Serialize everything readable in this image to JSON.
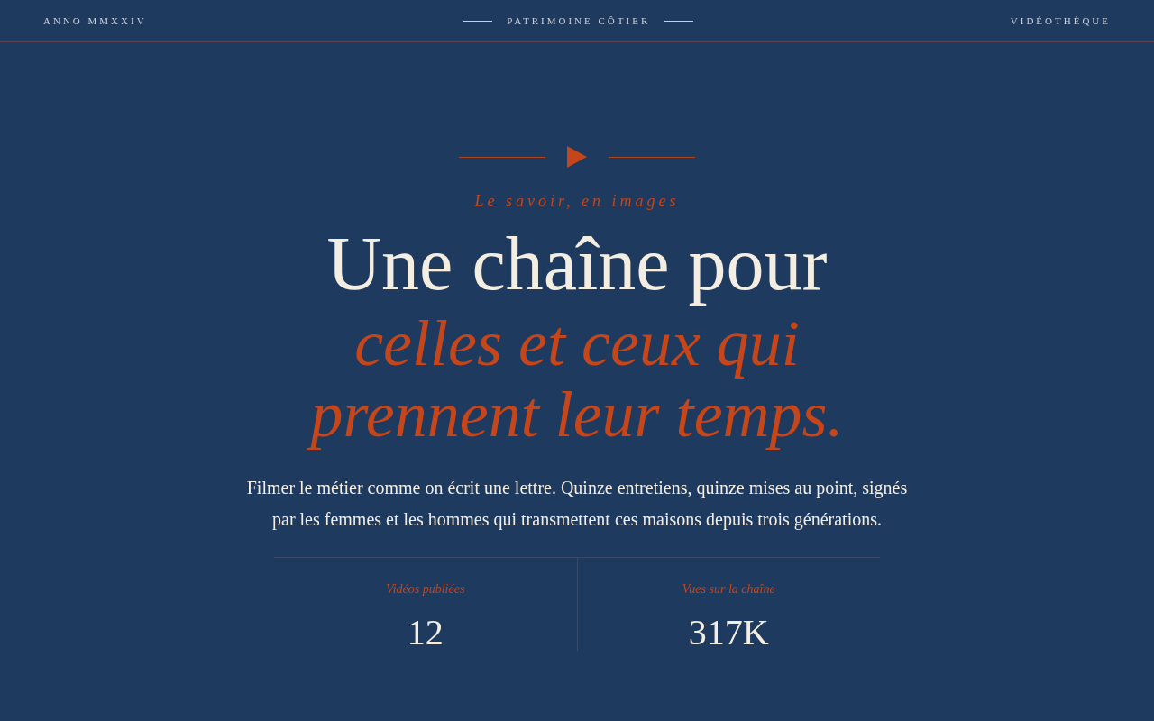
{
  "header": {
    "left": "ANNO MMXXIV",
    "center": "PATRIMOINE CÔTIER",
    "right": "VIDÉOTHÈQUE"
  },
  "hero": {
    "eyebrow": "Le savoir, en images",
    "title_line": "Une chaîne pour",
    "title_accent_lines": [
      "celles et ceux qui",
      "prennent leur temps."
    ],
    "lead": "Filmer le métier comme on écrit une lettre. Quinze entretiens, quinze mises au point, signés par les femmes et les hommes qui transmettent ces maisons depuis trois générations."
  },
  "stats": [
    {
      "label": "Vidéos publiées",
      "value": "12"
    },
    {
      "label": "Vues sur la chaîne",
      "value": "317K"
    }
  ]
}
